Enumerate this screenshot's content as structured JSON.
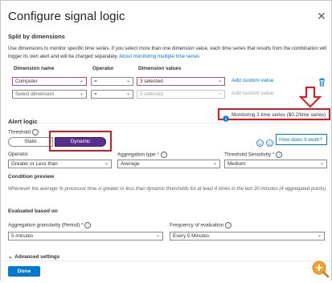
{
  "panel": {
    "title": "Configure signal logic",
    "close_glyph": "✕"
  },
  "split": {
    "heading": "Split by dimensions",
    "description": "Use dimensions to monitor specific time series. If you select more than one dimension value, each time series that results from the combination will trigger its own alert and will be charged separately. ",
    "description_link": "About monitoring multiple time series",
    "col_name": "Dimension name",
    "col_operator": "Operator",
    "col_values": "Dimension values",
    "rows": [
      {
        "name": "Computer",
        "operator": "=",
        "values": "3 selected",
        "add": "Add custom value"
      },
      {
        "name": "Select dimension",
        "operator": "=",
        "values": "0 selected",
        "add": "Add custom value"
      }
    ],
    "monitoring_text": "Monitoring 3 time series ($0.2/time series)"
  },
  "alert": {
    "heading": "Alert logic",
    "threshold_label": "Threshold",
    "threshold_options": [
      "Static",
      "Dynamic"
    ],
    "threshold_selected": "Dynamic",
    "feedback_link": "How does it work?",
    "operator_label": "Operator",
    "operator_value": "Greater or Less than",
    "agg_type_label": "Aggregation type",
    "agg_type_value": "Average",
    "sensitivity_label": "Threshold Sensitivity",
    "sensitivity_value": "Medium",
    "preview_heading": "Condition preview",
    "preview_text": "Whenever the average % processor time is greater or less than dynamic thresholds for at least 4 times in the last 20 minutes (4 aggregated points)"
  },
  "evaluated": {
    "heading": "Evaluated based on",
    "granularity_label": "Aggregation granularity (Period)",
    "granularity_value": "5 minutes",
    "frequency_label": "Frequency of evaluation",
    "frequency_value": "Every 5 Minutes"
  },
  "advanced": {
    "label": "Advanced settings"
  },
  "footer": {
    "done_label": "Done"
  },
  "colors": {
    "accent": "#0078d4",
    "annotation_red": "#e3171d",
    "toggle_purple": "#5c2d91",
    "zoom_orange": "#f0a22e"
  }
}
